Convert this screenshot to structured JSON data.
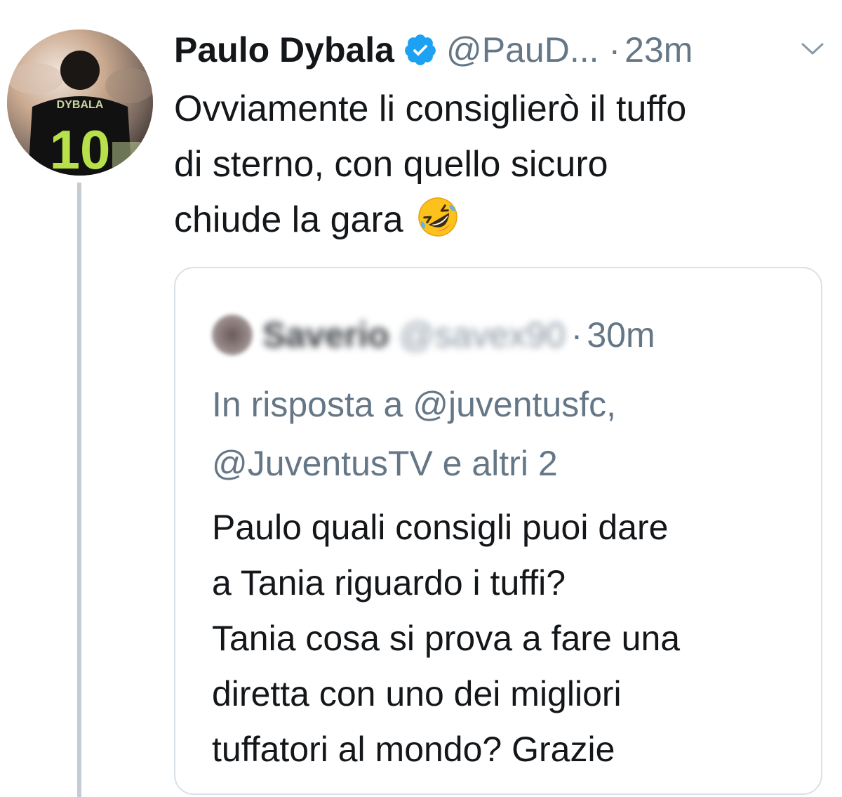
{
  "tweet": {
    "author_name": "Paulo Dybala",
    "author_handle": "@PauD...",
    "separator": "·",
    "time": "23m",
    "avatar": {
      "jersey_name": "DYBALA",
      "jersey_number": "10"
    },
    "text_lines": [
      "Ovviamente li consiglierò il tuffo",
      "di sterno, con quello sicuro",
      "chiude la gara"
    ],
    "emoji": "rolling-on-floor-laughing-emoji"
  },
  "quoted_tweet": {
    "author_name": "Saverio",
    "author_handle": "@savex90",
    "separator": "·",
    "time": "30m",
    "reply_lines": [
      "In risposta a @juventusfc,",
      "@JuventusTV e altri 2"
    ],
    "text_lines": [
      "Paulo quali consigli puoi dare",
      "a Tania riguardo i tuffi?",
      "Tania cosa si prova a fare una",
      "diretta con uno dei migliori",
      "tuffatori al mondo? Grazie"
    ]
  },
  "colors": {
    "verified_blue": "#1da1f2",
    "secondary_text": "#657786",
    "border": "#d9e1e8",
    "thread_line": "#c5ccd3",
    "jersey_number": "#b8e04a"
  }
}
